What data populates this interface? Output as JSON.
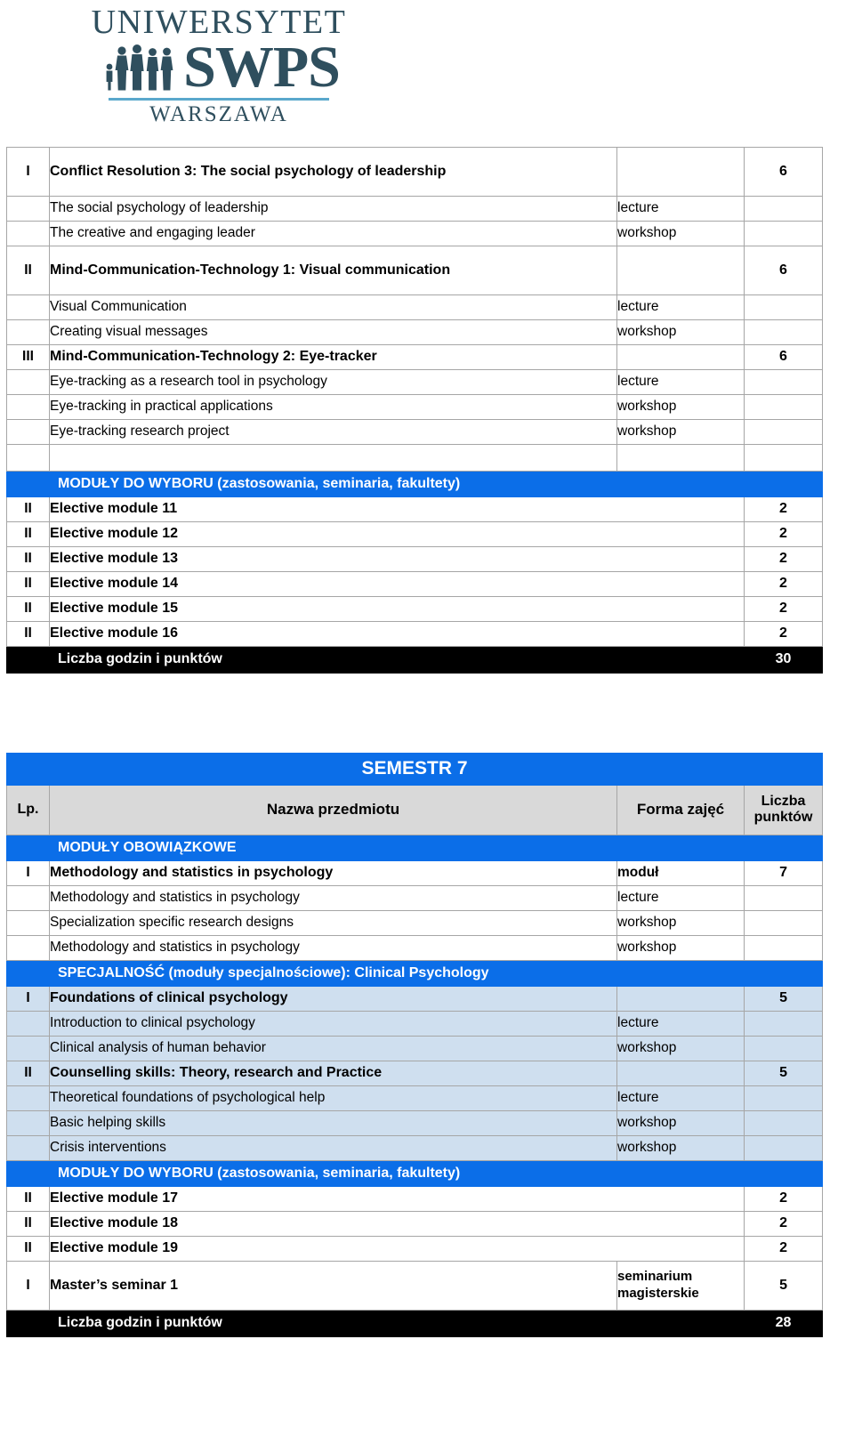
{
  "logo": {
    "university": "UNIWERSYTET",
    "brand": "SWPS",
    "city": "WARSZAWA",
    "people_icon": "people-silhouette-icon",
    "brand_color": "#2f4f5e",
    "rule_color": "#5aa8cc"
  },
  "colors": {
    "banner_blue": "#0b6ee8",
    "header_gray": "#d9d9d9",
    "spec_tint": "#cfdfef",
    "total_black": "#000000",
    "grid_line": "#a6a6a6"
  },
  "semester6": {
    "rows": [
      {
        "kind": "module",
        "lp": "I",
        "name": "Conflict Resolution 3: The social psychology of leadership",
        "form": "",
        "points": "6",
        "tall": true
      },
      {
        "kind": "course",
        "lp": "",
        "name": "The social psychology of leadership",
        "form": "lecture",
        "points": ""
      },
      {
        "kind": "course",
        "lp": "",
        "name": "The creative and engaging leader",
        "form": "workshop",
        "points": ""
      },
      {
        "kind": "module",
        "lp": "II",
        "name": "Mind-Communication-Technology 1: Visual communication",
        "form": "",
        "points": "6",
        "tall": true
      },
      {
        "kind": "course",
        "lp": "",
        "name": "Visual Communication",
        "form": "lecture",
        "points": ""
      },
      {
        "kind": "course",
        "lp": "",
        "name": "Creating visual messages",
        "form": "workshop",
        "points": ""
      },
      {
        "kind": "module",
        "lp": "III",
        "name": "Mind-Communication-Technology 2: Eye-tracker",
        "form": "",
        "points": "6"
      },
      {
        "kind": "course",
        "lp": "",
        "name": "Eye-tracking as a research tool in psychology",
        "form": "lecture",
        "points": ""
      },
      {
        "kind": "course",
        "lp": "",
        "name": "Eye-tracking in practical applications",
        "form": "workshop",
        "points": ""
      },
      {
        "kind": "course",
        "lp": "",
        "name": "Eye-tracking research project",
        "form": "workshop",
        "points": ""
      },
      {
        "kind": "empty",
        "lp": "",
        "name": "",
        "form": "",
        "points": ""
      },
      {
        "kind": "banner",
        "label": "MODUŁY DO WYBORU (zastosowania, seminaria, fakultety)"
      },
      {
        "kind": "elective",
        "lp": "II",
        "name": "Elective module 11",
        "points": "2"
      },
      {
        "kind": "elective",
        "lp": "II",
        "name": "Elective module 12",
        "points": "2"
      },
      {
        "kind": "elective",
        "lp": "II",
        "name": "Elective module 13",
        "points": "2"
      },
      {
        "kind": "elective",
        "lp": "II",
        "name": "Elective module 14",
        "points": "2"
      },
      {
        "kind": "elective",
        "lp": "II",
        "name": "Elective module 15",
        "points": "2"
      },
      {
        "kind": "elective",
        "lp": "II",
        "name": "Elective module 16",
        "points": "2"
      },
      {
        "kind": "total",
        "lp": "",
        "name": "Liczba godzin i punktów",
        "form": "",
        "points": "30"
      }
    ]
  },
  "semester7": {
    "title": "SEMESTR 7",
    "columns": {
      "lp": "Lp.",
      "name": "Nazwa przedmiotu",
      "form": "Forma zajęć",
      "points_line1": "Liczba",
      "points_line2": "punktów"
    },
    "rows": [
      {
        "kind": "banner",
        "label": "MODUŁY OBOWIĄZKOWE"
      },
      {
        "kind": "module",
        "lp": "I",
        "name": "Methodology and statistics in psychology",
        "form": "moduł",
        "points": "7"
      },
      {
        "kind": "course",
        "lp": "",
        "name": "Methodology and statistics in psychology",
        "form": "lecture",
        "points": ""
      },
      {
        "kind": "course",
        "lp": "",
        "name": "Specialization specific research designs",
        "form": "workshop",
        "points": ""
      },
      {
        "kind": "course",
        "lp": "",
        "name": "Methodology and statistics in psychology",
        "form": "workshop",
        "points": ""
      },
      {
        "kind": "banner",
        "label": "SPECJALNOŚĆ (moduły specjalnościowe): Clinical Psychology"
      },
      {
        "kind": "module",
        "spec": true,
        "lp": "I",
        "name": "Foundations of clinical psychology",
        "form": "",
        "points": "5"
      },
      {
        "kind": "course",
        "spec": true,
        "lp": "",
        "name": "Introduction to clinical psychology",
        "form": "lecture",
        "points": ""
      },
      {
        "kind": "course",
        "spec": true,
        "lp": "",
        "name": "Clinical analysis of human behavior",
        "form": "workshop",
        "points": ""
      },
      {
        "kind": "module",
        "spec": true,
        "lp": "II",
        "name": "Counselling skills: Theory, research and Practice",
        "form": "",
        "points": "5"
      },
      {
        "kind": "course",
        "spec": true,
        "lp": "",
        "name": "Theoretical foundations of psychological help",
        "form": "lecture",
        "points": ""
      },
      {
        "kind": "course",
        "spec": true,
        "lp": "",
        "name": "Basic helping skills",
        "form": "workshop",
        "points": ""
      },
      {
        "kind": "course",
        "spec": true,
        "lp": "",
        "name": "Crisis interventions",
        "form": "workshop",
        "points": ""
      },
      {
        "kind": "banner",
        "label": "MODUŁY DO WYBORU (zastosowania, seminaria, fakultety)"
      },
      {
        "kind": "elective",
        "lp": "II",
        "name": "Elective module 17",
        "points": "2"
      },
      {
        "kind": "elective",
        "lp": "II",
        "name": "Elective module 18",
        "points": "2"
      },
      {
        "kind": "elective",
        "lp": "II",
        "name": "Elective module 19",
        "points": "2"
      },
      {
        "kind": "module",
        "lp": "I",
        "name": "Master’s seminar 1",
        "form": "seminarium magisterskie",
        "form_lines": [
          "seminarium",
          "magisterskie"
        ],
        "points": "5",
        "twoline": true
      },
      {
        "kind": "total",
        "lp": "",
        "name": "Liczba godzin i punktów",
        "form": "",
        "points": "28"
      }
    ]
  }
}
